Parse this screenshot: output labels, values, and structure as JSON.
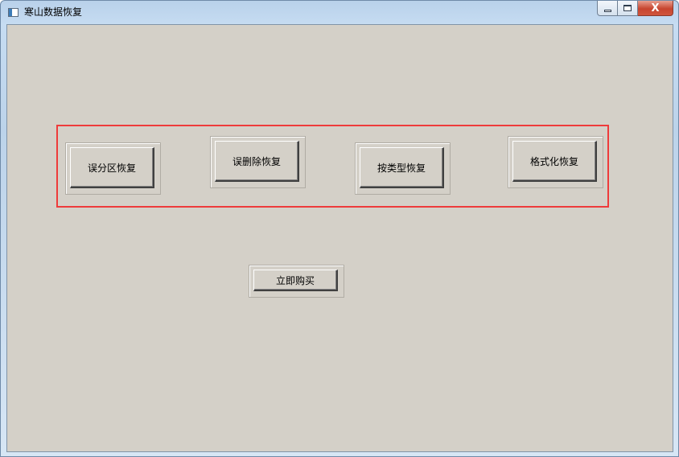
{
  "window": {
    "title": "寒山数据恢复",
    "icon": "app-window-icon",
    "controls": {
      "minimize": "minimize-icon",
      "maximize": "maximize-icon",
      "close_label": "X"
    }
  },
  "main": {
    "recovery_buttons": [
      {
        "label": "误分区恢复"
      },
      {
        "label": "误删除恢复"
      },
      {
        "label": "按类型恢复"
      },
      {
        "label": "格式化恢复"
      }
    ],
    "buy_button": {
      "label": "立即购买"
    }
  },
  "colors": {
    "client_background": "#d4d0c8",
    "highlight_border": "#ee3b3b",
    "close_button": "#c7452f"
  }
}
